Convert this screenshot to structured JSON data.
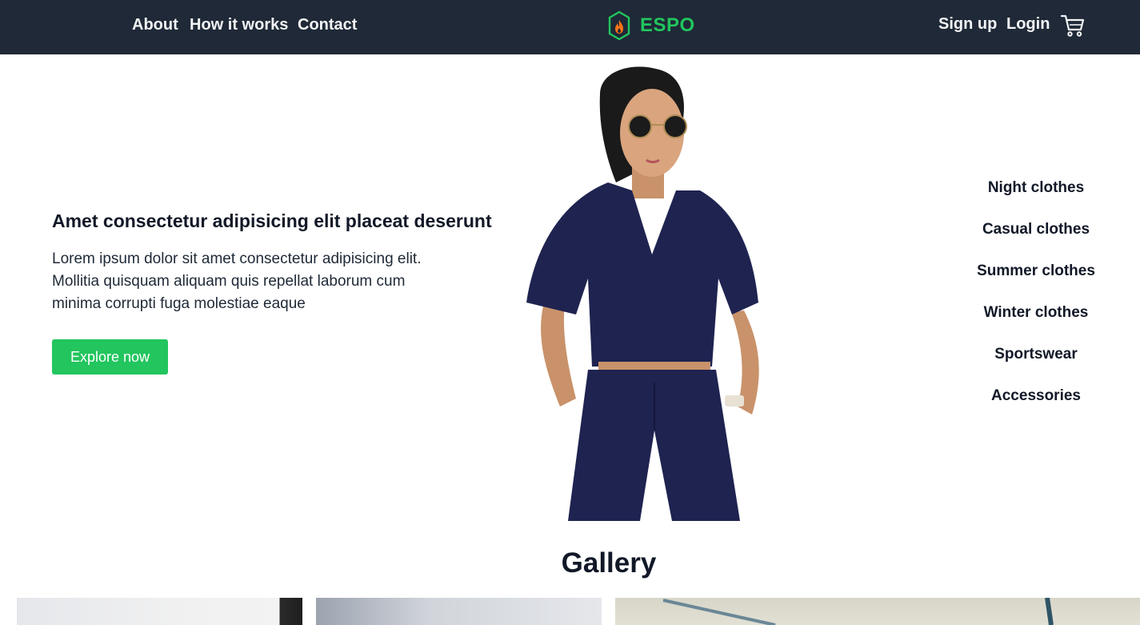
{
  "nav": {
    "links": [
      "About",
      "How it works",
      "Contact"
    ],
    "brand": "ESPO",
    "auth": [
      "Sign up",
      "Login"
    ]
  },
  "hero": {
    "heading": "Amet consectetur adipisicing elit placeat deserunt",
    "text": "Lorem ipsum dolor sit amet consectetur adipisicing elit. Mollitia quisquam aliquam quis repellat laborum cum minima corrupti fuga molestiae eaque",
    "cta": "Explore now"
  },
  "categories": [
    "Night clothes",
    "Casual clothes",
    "Summer clothes",
    "Winter clothes",
    "Sportswear",
    "Accessories"
  ],
  "gallery": {
    "title": "Gallery"
  },
  "colors": {
    "navbar_bg": "#1f2937",
    "accent": "#22c55e",
    "logo_flame": "#f97316"
  },
  "icons": [
    "shield-logo-icon",
    "cart-icon"
  ]
}
